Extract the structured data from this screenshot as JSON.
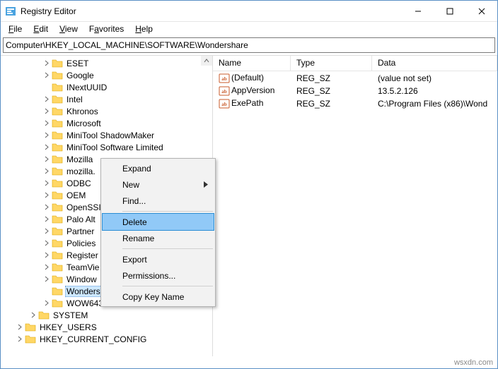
{
  "window": {
    "title": "Registry Editor"
  },
  "menu": {
    "items": [
      {
        "label": "File",
        "accel": "F"
      },
      {
        "label": "Edit",
        "accel": "E"
      },
      {
        "label": "View",
        "accel": "V"
      },
      {
        "label": "Favorites",
        "accel": "a"
      },
      {
        "label": "Help",
        "accel": "H"
      }
    ]
  },
  "address": "Computer\\HKEY_LOCAL_MACHINE\\SOFTWARE\\Wondershare",
  "tree": {
    "items": [
      {
        "indent": 56,
        "exp": "closed",
        "label": "ESET"
      },
      {
        "indent": 56,
        "exp": "closed",
        "label": "Google"
      },
      {
        "indent": 56,
        "exp": "none",
        "label": "INextUUID"
      },
      {
        "indent": 56,
        "exp": "closed",
        "label": "Intel"
      },
      {
        "indent": 56,
        "exp": "closed",
        "label": "Khronos"
      },
      {
        "indent": 56,
        "exp": "closed",
        "label": "Microsoft"
      },
      {
        "indent": 56,
        "exp": "closed",
        "label": "MiniTool ShadowMaker"
      },
      {
        "indent": 56,
        "exp": "closed",
        "label": "MiniTool Software Limited"
      },
      {
        "indent": 56,
        "exp": "closed",
        "label": "Mozilla"
      },
      {
        "indent": 56,
        "exp": "closed",
        "label": "mozilla."
      },
      {
        "indent": 56,
        "exp": "closed",
        "label": "ODBC"
      },
      {
        "indent": 56,
        "exp": "closed",
        "label": "OEM"
      },
      {
        "indent": 56,
        "exp": "closed",
        "label": "OpenSSI"
      },
      {
        "indent": 56,
        "exp": "closed",
        "label": "Palo Alt"
      },
      {
        "indent": 56,
        "exp": "closed",
        "label": "Partner"
      },
      {
        "indent": 56,
        "exp": "closed",
        "label": "Policies"
      },
      {
        "indent": 56,
        "exp": "closed",
        "label": "Register"
      },
      {
        "indent": 56,
        "exp": "closed",
        "label": "TeamVie"
      },
      {
        "indent": 56,
        "exp": "closed",
        "label": "Window"
      },
      {
        "indent": 56,
        "exp": "none",
        "label": "Wondershare",
        "selected": true
      },
      {
        "indent": 56,
        "exp": "closed",
        "label": "WOW6432Node"
      },
      {
        "indent": 37,
        "exp": "closed",
        "label": "SYSTEM"
      },
      {
        "indent": 18,
        "exp": "closed",
        "label": "HKEY_USERS"
      },
      {
        "indent": 18,
        "exp": "closed",
        "label": "HKEY_CURRENT_CONFIG"
      }
    ]
  },
  "list": {
    "columns": {
      "name": "Name",
      "type": "Type",
      "data": "Data"
    },
    "rows": [
      {
        "name": "(Default)",
        "type": "REG_SZ",
        "data": "(value not set)"
      },
      {
        "name": "AppVersion",
        "type": "REG_SZ",
        "data": "13.5.2.126"
      },
      {
        "name": "ExePath",
        "type": "REG_SZ",
        "data": "C:\\Program Files (x86)\\Wond"
      }
    ]
  },
  "context_menu": {
    "items": [
      {
        "label": "Expand"
      },
      {
        "label": "New",
        "submenu": true
      },
      {
        "label": "Find..."
      },
      {
        "sep": true
      },
      {
        "label": "Delete",
        "highlight": true
      },
      {
        "label": "Rename"
      },
      {
        "sep": true
      },
      {
        "label": "Export"
      },
      {
        "label": "Permissions..."
      },
      {
        "sep": true
      },
      {
        "label": "Copy Key Name"
      }
    ]
  },
  "watermark": "wsxdn.com"
}
